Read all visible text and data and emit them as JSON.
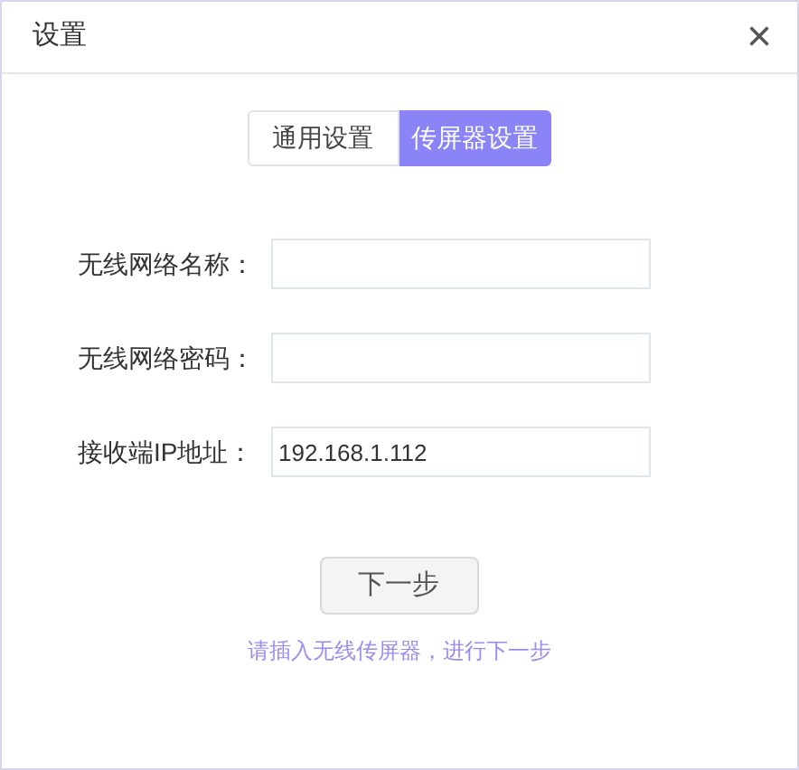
{
  "window": {
    "title": "设置",
    "close": "×"
  },
  "tabs": [
    {
      "label": "通用设置",
      "selected": false
    },
    {
      "label": "传屏器设置",
      "selected": true
    }
  ],
  "fields": [
    {
      "label": "无线网络名称："
    },
    {
      "label": "无线网络密码："
    },
    {
      "label": "接收端IP地址：",
      "value": "192.168.1.112"
    }
  ],
  "next_button": "下一步",
  "hint": "请插入无线传屏器，进行下一步"
}
